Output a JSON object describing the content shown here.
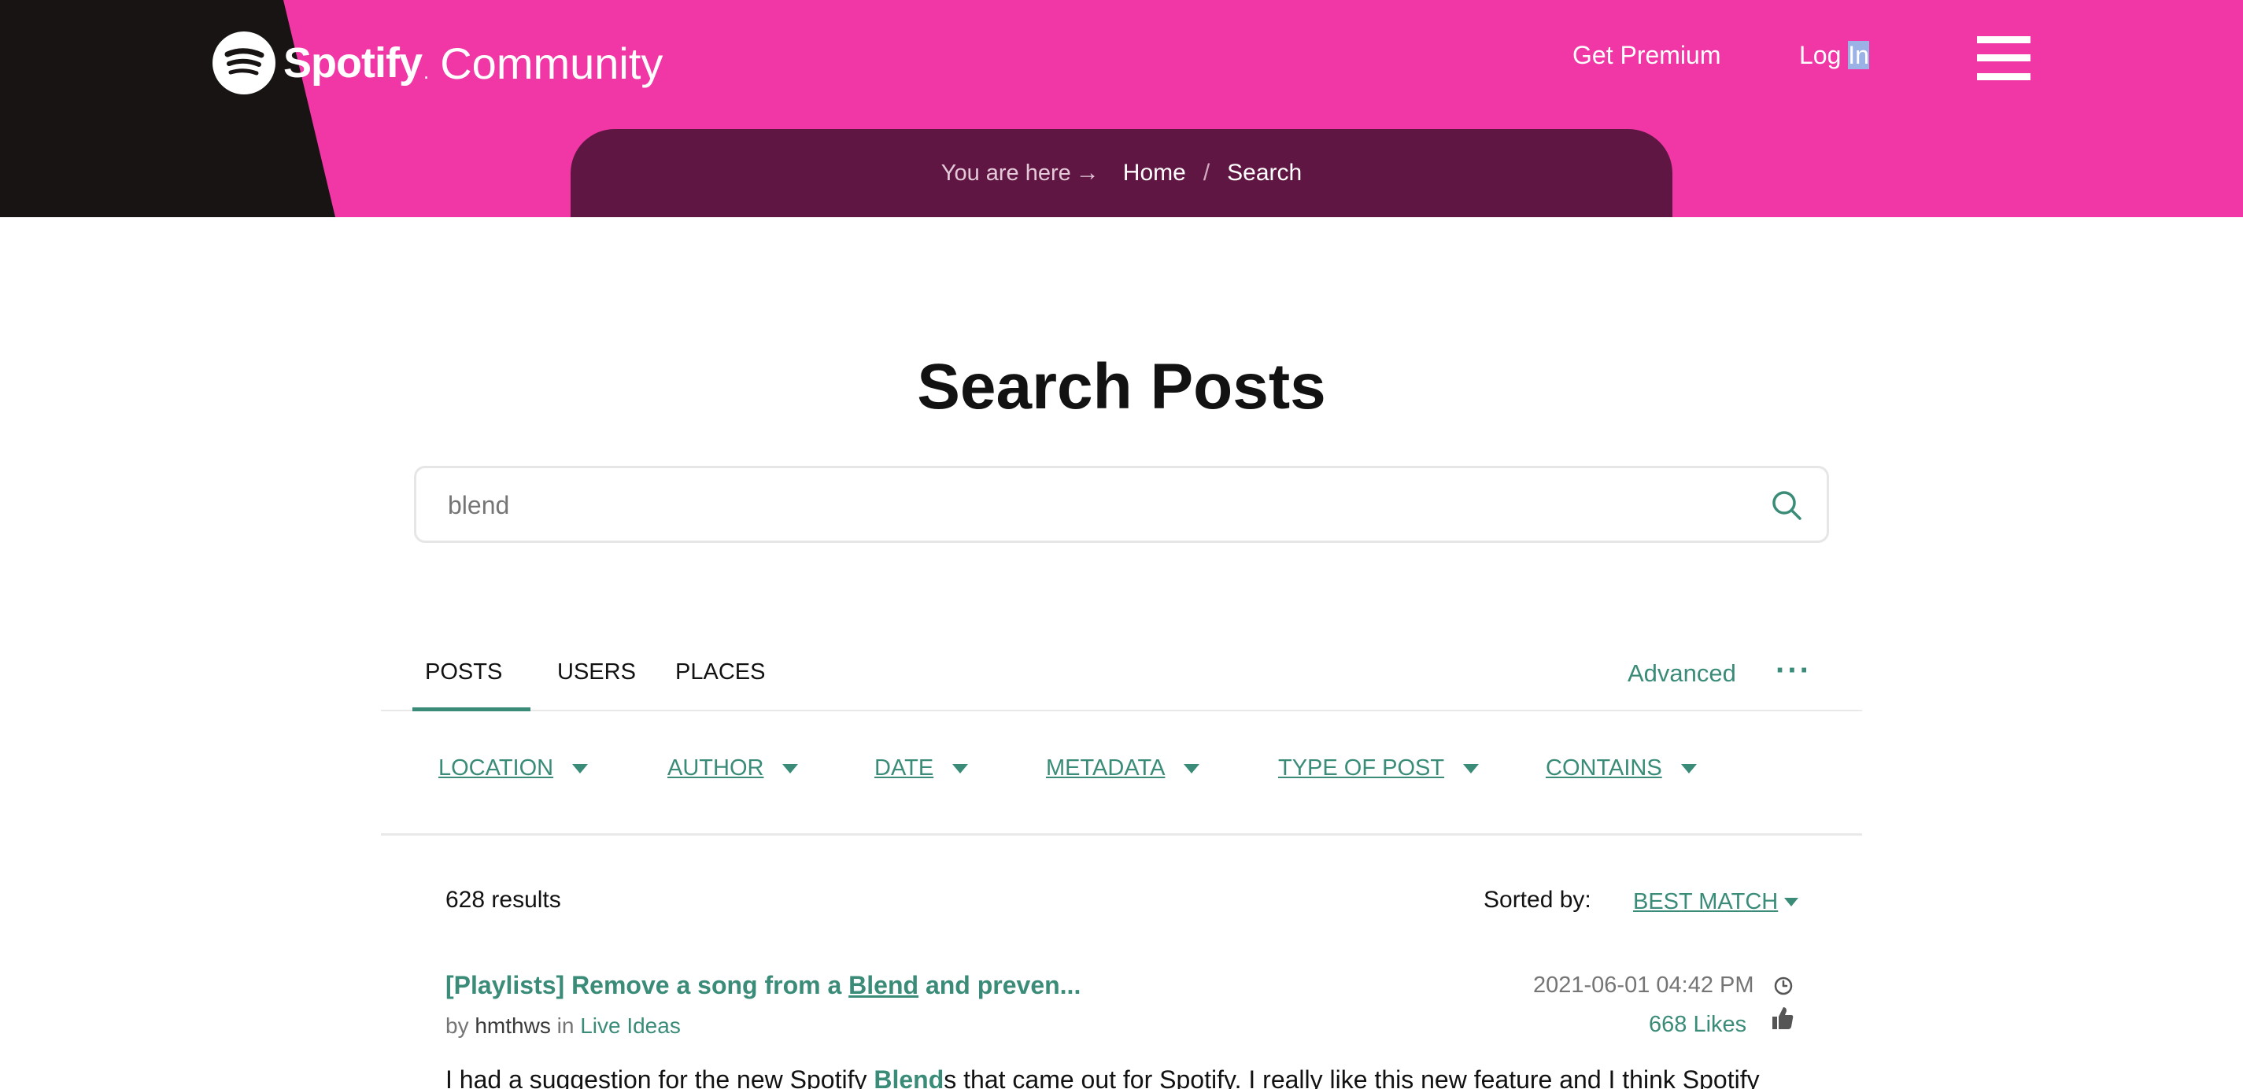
{
  "header": {
    "logo_word": "Spotify",
    "logo_dot": ".",
    "logo_community": "Community",
    "nav": {
      "get_premium": "Get Premium",
      "login_prefix": "Log ",
      "login_highlight": "In"
    },
    "breadcrumb": {
      "prefix": "You are here",
      "arrow": "→",
      "home": "Home",
      "separator": "/",
      "current": "Search"
    }
  },
  "page_title": "Search Posts",
  "search": {
    "value": "blend",
    "placeholder": "blend"
  },
  "tabs": {
    "posts": "POSTS",
    "users": "USERS",
    "places": "PLACES",
    "active": "POSTS",
    "advanced": "Advanced",
    "more": "···"
  },
  "filters": {
    "location": "LOCATION",
    "author": "AUTHOR",
    "date": "DATE",
    "metadata": "METADATA",
    "type_of_post": "TYPE OF POST",
    "contains": "CONTAINS"
  },
  "results": {
    "count": "628 results",
    "sorted_label": "Sorted by:",
    "sorted_value": "BEST MATCH",
    "items": [
      {
        "title_before": "[Playlists] Remove a song from a ",
        "title_hit": "Blend",
        "title_after": " and preven...",
        "by_label": "by",
        "author": "hmthws",
        "in_label": "in",
        "place": "Live Ideas",
        "date": "2021-06-01 04:42 PM",
        "likes": "668 Likes",
        "snippet_before": "I had a suggestion for the new Spotify ",
        "snippet_hit": "Blend",
        "snippet_after": "s that came out for Spotify. I really like this new feature and I think Spotify"
      }
    ]
  },
  "colors": {
    "header_pink": "#f037a5",
    "header_black": "#191414",
    "breadcrumb_bg": "#5f1642",
    "accent_green": "#3a8c78"
  }
}
